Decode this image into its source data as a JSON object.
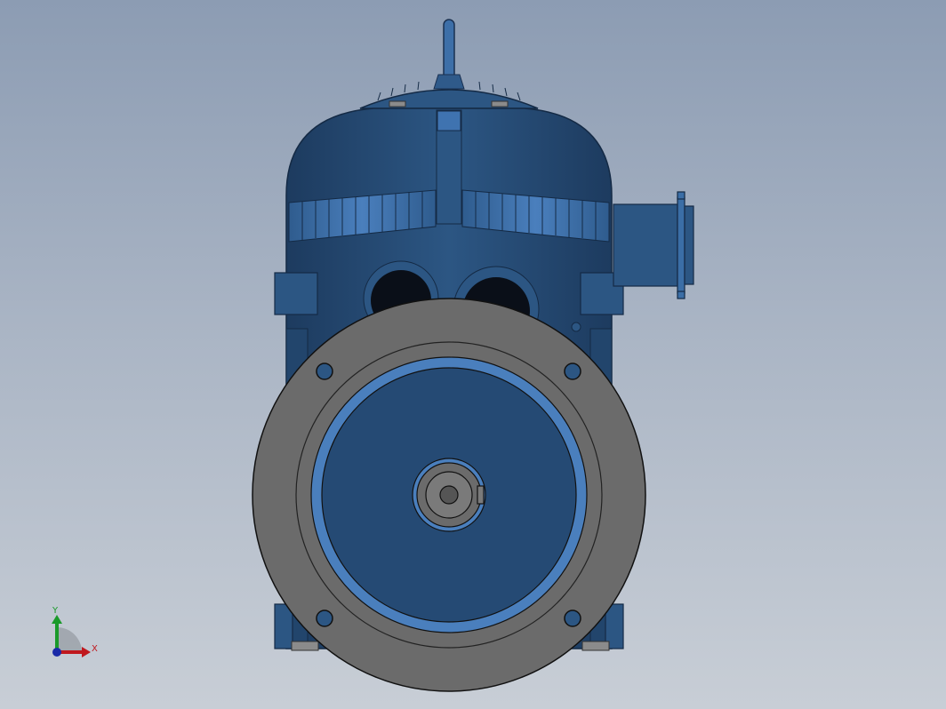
{
  "viewport": {
    "background_top": "#8c9cb3",
    "background_bottom": "#c8ced6"
  },
  "model": {
    "body_color": "#2a4f7a",
    "flange_color": "#6b6b6b",
    "rib_color": "#3b6ea6"
  },
  "triad": {
    "x_label": "X",
    "y_label": "Y",
    "x_color": "#c0181e",
    "y_color": "#1a9a2a",
    "z_color": "#1a2aa8"
  }
}
